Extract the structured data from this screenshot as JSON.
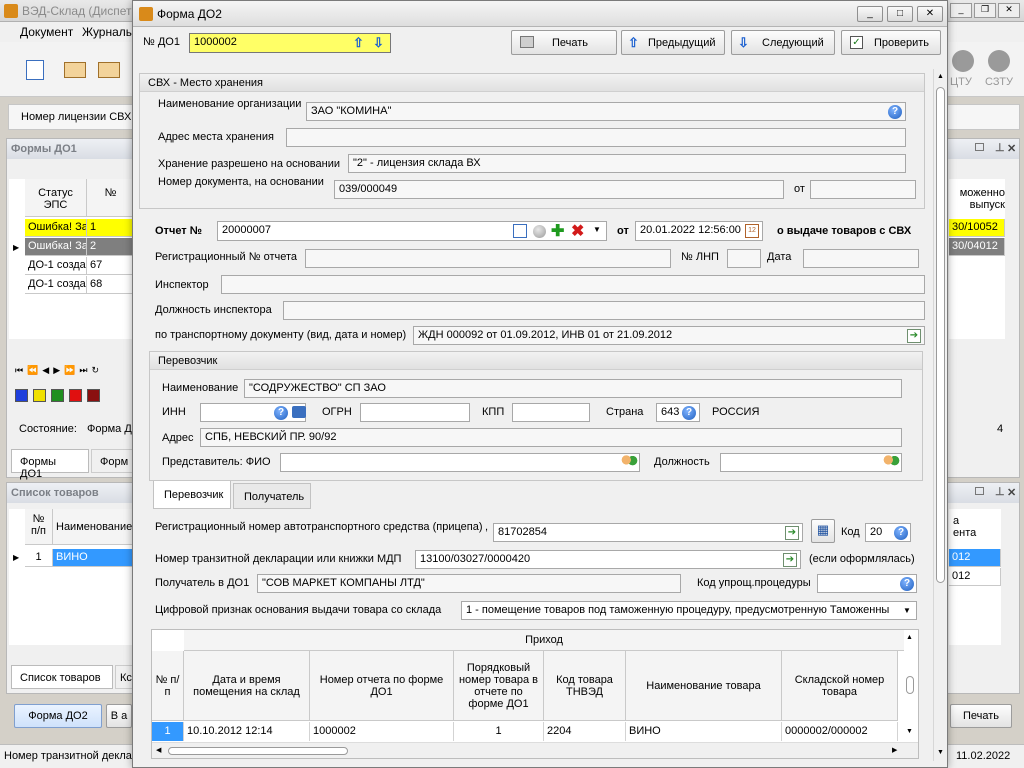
{
  "bg": {
    "app_title": "ВЭД-Склад (Диспет",
    "menu": [
      "Документ",
      "Журналы"
    ],
    "license_label": "Номер лицензии СВХ",
    "forms_panel_title": "Формы ДО1",
    "forms_grid": {
      "headers": [
        "Статус ЭПС",
        "№"
      ],
      "rows": [
        {
          "status": "Ошибка! За",
          "num": "1"
        },
        {
          "status": "Ошибка! За",
          "num": "2"
        },
        {
          "status": "ДО-1 созда",
          "num": "67"
        },
        {
          "status": "ДО-1 созда",
          "num": "68"
        }
      ],
      "right_header_1": "моженно",
      "right_header_2": "выпуск",
      "right_rows": [
        "30/10052",
        "30/04012"
      ]
    },
    "state_label": "Состояние:",
    "state_value": "Форма Д",
    "state_right": "4",
    "tabs_top": [
      "Формы ДО1",
      "Форм"
    ],
    "goods_title": "Список товаров",
    "goods_headers": [
      "№ п/п",
      "Наименование"
    ],
    "goods_row": {
      "num": "1",
      "name": "ВИНО"
    },
    "goods_right_header": "а\nента",
    "goods_right_rows": [
      "012",
      "012"
    ],
    "tabs_bottom": [
      "Список товаров",
      "Кс"
    ],
    "footer_buttons": [
      "Форма ДО2",
      "В а",
      "Печать"
    ],
    "right_icon_labels": [
      "ЦТУ",
      "СЗТУ"
    ],
    "status_left": "Номер транзитной декла",
    "status_right": "11.02.2022",
    "colors": [
      "#1f3fdc",
      "#f0e000",
      "#1f8f1f",
      "#e01010",
      "#8a1010"
    ]
  },
  "dlg": {
    "title": "Форма ДО2",
    "do1_label": "№ ДО1",
    "do1_value": "1000002",
    "buttons": {
      "print": "Печать",
      "prev": "Предыдущий",
      "next": "Следующий",
      "check": "Проверить"
    },
    "svh": {
      "title": "СВХ - Место хранения",
      "org_label": "Наименование организации",
      "org_value": "ЗАО \"КОМИНА\"",
      "addr_label": "Адрес места хранения",
      "addr_value": "",
      "basis_label": "Хранение разрешено на основании",
      "basis_value": "\"2\" - лицензия склада ВХ",
      "docnum_label": "Номер документа, на основании",
      "docnum_value": "039/000049",
      "from_label": "от",
      "from_value": ""
    },
    "report": {
      "label": "Отчет №",
      "value": "20000007",
      "from_label": "от",
      "date_value": "20.01.2022 12:56:00",
      "suffix": "о выдаче товаров с СВХ",
      "reg_label": "Регистрационный № отчета",
      "lnp_label": "№ ЛНП",
      "date_label": "Дата",
      "inspector_label": "Инспектор",
      "inspector_pos_label": "Должность инспектора",
      "transport_label": "по транспортному документу (вид, дата и номер)",
      "transport_value": "ЖДН 000092 от 01.09.2012, ИНВ 01 от 21.09.2012"
    },
    "carrier": {
      "title": "Перевозчик",
      "name_label": "Наименование",
      "name_value": "\"СОДРУЖЕСТВО\" СП ЗАО",
      "inn_label": "ИНН",
      "ogrn_label": "ОГРН",
      "kpp_label": "КПП",
      "country_label": "Страна",
      "country_code": "643",
      "country_name": "РОССИЯ",
      "addr_label": "Адрес",
      "addr_value": "СПБ, НЕВСКИЙ ПР. 90/92",
      "rep_label": "Представитель: ФИО",
      "pos_label": "Должность"
    },
    "tabs": [
      "Перевозчик",
      "Получатель"
    ],
    "vehicle_label": "Регистрационный номер автотранспортного средства (прицепа)",
    "vehicle_value": "81702854",
    "code_label": "Код",
    "code_value": "20",
    "transit_label": "Номер транзитной декларации или книжки МДП",
    "transit_value": "13100/03027/0000420",
    "transit_note": "(если оформлялась)",
    "recipient_label": "Получатель в ДО1",
    "recipient_value": "\"СОВ МАРКЕТ КОМПАНЫ ЛТД\"",
    "simpl_label": "Код упрощ.процедуры",
    "digital_label": "Цифровой признак основания  выдачи товара со склада",
    "digital_value": "1 - помещение товаров под таможенную процедуру, предусмотренную Таможенны",
    "table": {
      "group_header": "Приход",
      "headers": [
        "№ п/п",
        "Дата и время помещения на склад",
        "Номер отчета по форме ДО1",
        "Порядковый номер товара в отчете по форме ДО1",
        "Код товара ТНВЭД",
        "Наименование товара",
        "Складской номер товара"
      ],
      "rows": [
        [
          "1",
          "10.10.2012 12:14",
          "1000002",
          "1",
          "2204",
          "ВИНО",
          "0000002/000002"
        ]
      ]
    }
  }
}
